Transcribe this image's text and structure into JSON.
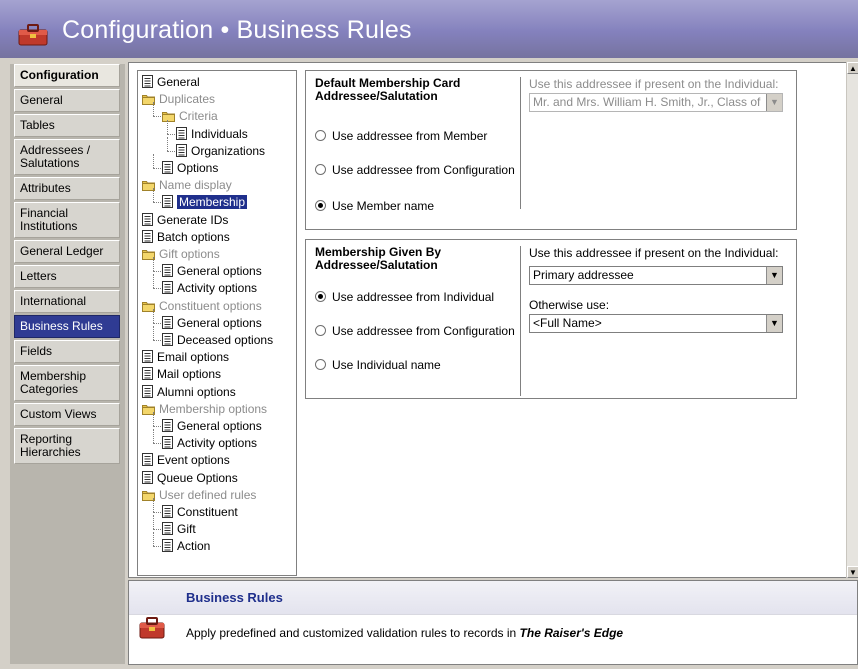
{
  "window": {
    "title": "Configuration • Business Rules",
    "icon": "toolbox-icon",
    "accent": "#8481bd"
  },
  "nav": {
    "header": "Configuration",
    "items": [
      {
        "label": "General"
      },
      {
        "label": "Tables"
      },
      {
        "label": "Addressees / Salutations"
      },
      {
        "label": "Attributes"
      },
      {
        "label": "Financial Institutions"
      },
      {
        "label": "General Ledger"
      },
      {
        "label": "Letters"
      },
      {
        "label": "International"
      },
      {
        "label": "Business Rules"
      },
      {
        "label": "Fields"
      },
      {
        "label": "Membership Categories"
      },
      {
        "label": "Custom Views"
      },
      {
        "label": "Reporting Hierarchies"
      }
    ],
    "active_color": "#2f3b93"
  },
  "tree": {
    "items": [
      {
        "label": "General"
      },
      {
        "label": "Duplicates"
      },
      {
        "label": "Criteria"
      },
      {
        "label": "Individuals"
      },
      {
        "label": "Organizations"
      },
      {
        "label": "Options"
      },
      {
        "label": "Name display"
      },
      {
        "label": "Membership"
      },
      {
        "label": "Generate IDs"
      },
      {
        "label": "Batch options"
      },
      {
        "label": "Gift options"
      },
      {
        "label": "General options"
      },
      {
        "label": "Activity options"
      },
      {
        "label": "Constituent options"
      },
      {
        "label": "General options"
      },
      {
        "label": "Deceased options"
      },
      {
        "label": "Email options"
      },
      {
        "label": "Mail options"
      },
      {
        "label": "Alumni options"
      },
      {
        "label": "Membership options"
      },
      {
        "label": "General options"
      },
      {
        "label": "Activity options"
      },
      {
        "label": "Event options"
      },
      {
        "label": "Queue Options"
      },
      {
        "label": "User defined rules"
      },
      {
        "label": "Constituent"
      },
      {
        "label": "Gift"
      },
      {
        "label": "Action"
      }
    ]
  },
  "card_group": {
    "title": "Default Membership Card Addressee/Salutation",
    "options": [
      {
        "label": "Use addressee from Member",
        "checked": false
      },
      {
        "label": "Use addressee from Configuration",
        "checked": false
      },
      {
        "label": "Use Member name",
        "checked": true
      }
    ],
    "use_if_label": "Use this addressee if present on the Individual:",
    "use_if_value": "Mr. and Mrs. William H. Smith, Jr., Class of"
  },
  "given_group": {
    "title": "Membership Given By Addressee/Salutation",
    "options": [
      {
        "label": "Use addressee from Individual",
        "checked": true
      },
      {
        "label": "Use addressee from Configuration",
        "checked": false
      },
      {
        "label": "Use Individual name",
        "checked": false
      }
    ],
    "use_if_label": "Use this addressee if present on the Individual:",
    "use_if_value": "Primary addressee",
    "otherwise_label": "Otherwise use:",
    "otherwise_value": "<Full Name>"
  },
  "info": {
    "title": "Business Rules",
    "desc_prefix": "Apply predefined and customized validation rules to records in ",
    "desc_product": "The Raiser's Edge",
    "title_color": "#1f2f8c"
  }
}
